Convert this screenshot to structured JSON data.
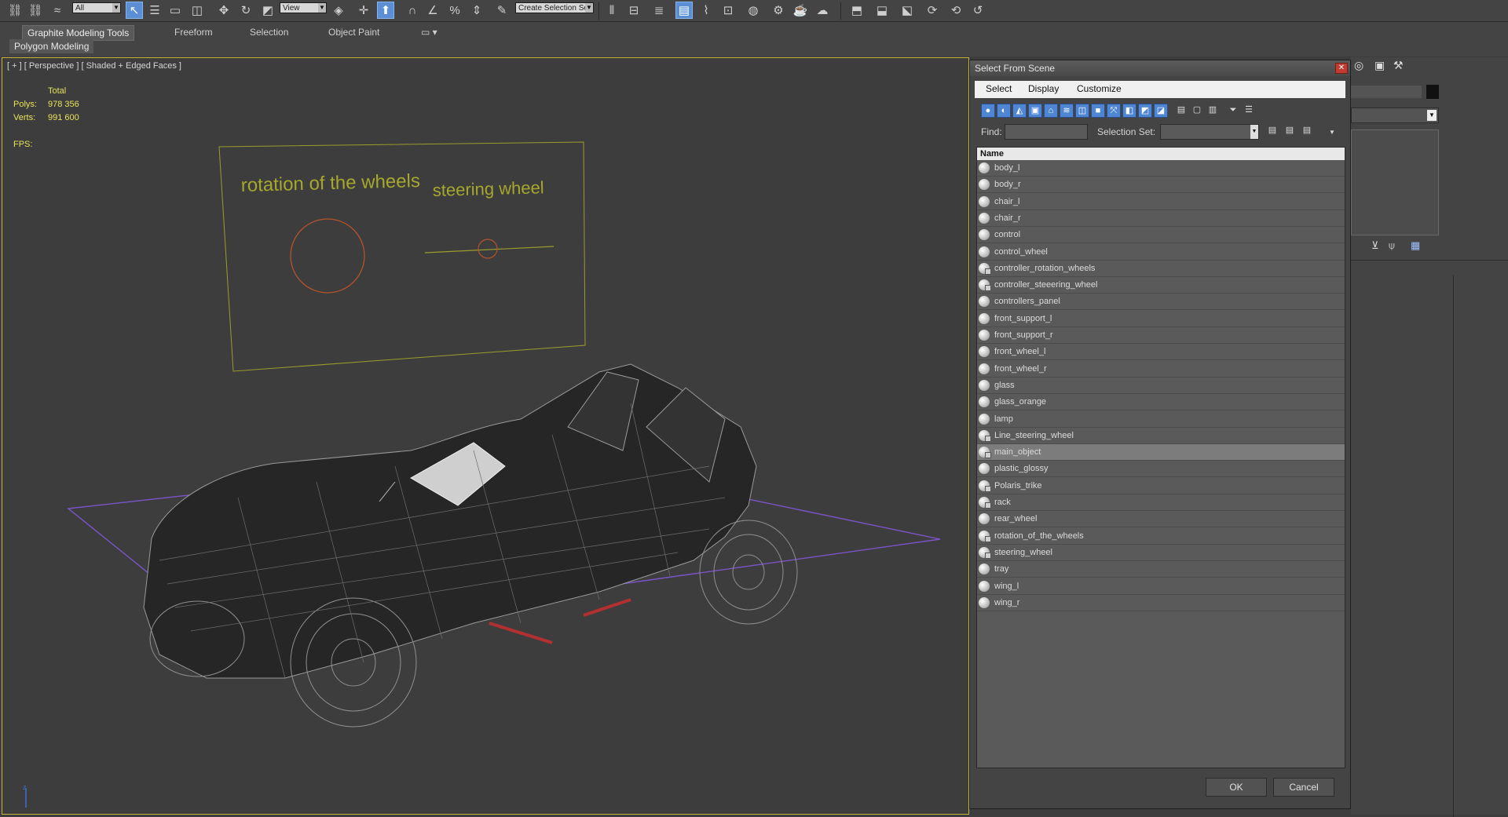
{
  "toolbar": {
    "selection_filter": "All",
    "reference_coord": "View",
    "named_selection_set": "Create Selection Se"
  },
  "ribbon": {
    "tabs": [
      "Graphite Modeling Tools",
      "Freeform",
      "Selection",
      "Object Paint"
    ],
    "panel": "Polygon Modeling"
  },
  "viewport": {
    "label": "[ + ] [ Perspective ] [ Shaded + Edged Faces ]",
    "stats": {
      "total_label": "Total",
      "polys_label": "Polys:",
      "polys_value": "978 356",
      "verts_label": "Verts:",
      "verts_value": "991 600",
      "fps_label": "FPS:"
    },
    "scene_text": {
      "rotation": "rotation of the wheels",
      "steering": "steering wheel"
    }
  },
  "dialog": {
    "title": "Select From Scene",
    "menu": [
      "Select",
      "Display",
      "Customize"
    ],
    "find_label": "Find:",
    "find_value": "",
    "selection_set_label": "Selection Set:",
    "selection_set_value": "",
    "column_header": "Name",
    "items": [
      {
        "name": "body_l",
        "linked": false
      },
      {
        "name": "body_r",
        "linked": false
      },
      {
        "name": "chair_l",
        "linked": false
      },
      {
        "name": "chair_r",
        "linked": false
      },
      {
        "name": "control",
        "linked": false
      },
      {
        "name": "control_wheel",
        "linked": false
      },
      {
        "name": "controller_rotation_wheels",
        "linked": true
      },
      {
        "name": "controller_steeering_wheel",
        "linked": true
      },
      {
        "name": "controllers_panel",
        "linked": false
      },
      {
        "name": "front_support_l",
        "linked": false
      },
      {
        "name": "front_support_r",
        "linked": false
      },
      {
        "name": "front_wheel_l",
        "linked": false
      },
      {
        "name": "front_wheel_r",
        "linked": false
      },
      {
        "name": "glass",
        "linked": false
      },
      {
        "name": "glass_orange",
        "linked": false
      },
      {
        "name": "lamp",
        "linked": false
      },
      {
        "name": "Line_steering_wheel",
        "linked": true
      },
      {
        "name": "main_object",
        "linked": true,
        "selected": true
      },
      {
        "name": "plastic_glossy",
        "linked": false
      },
      {
        "name": "Polaris_trike",
        "linked": true
      },
      {
        "name": "rack",
        "linked": true
      },
      {
        "name": "rear_wheel",
        "linked": false
      },
      {
        "name": "rotation_of_the_wheels",
        "linked": true
      },
      {
        "name": "steering_wheel",
        "linked": true
      },
      {
        "name": "tray",
        "linked": false
      },
      {
        "name": "wing_l",
        "linked": false
      },
      {
        "name": "wing_r",
        "linked": false
      }
    ],
    "ok_label": "OK",
    "cancel_label": "Cancel"
  },
  "colors": {
    "stat_yellow": "#e7e35a",
    "shape_text": "#a5a82c",
    "circle": "#b4532a",
    "grid": "#7a55c8",
    "wire": "#9a9a9a"
  }
}
